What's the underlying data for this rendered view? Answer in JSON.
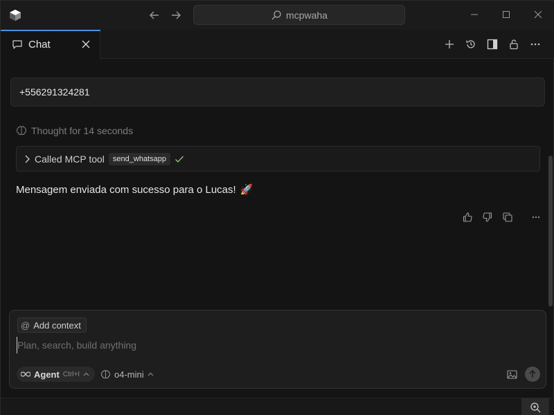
{
  "titlebar": {
    "search_text": "mcpwaha",
    "icons": [
      "app-logo",
      "arrow-left-icon",
      "arrow-right-icon",
      "search-icon",
      "minimize-icon",
      "maximize-icon",
      "close-icon"
    ]
  },
  "tabbar": {
    "active_tab_label": "Chat",
    "accent_color": "#4a90e2",
    "actions": [
      "plus-icon",
      "history-icon",
      "sidebar-toggle-icon",
      "unlock-icon",
      "more-icon"
    ]
  },
  "chat": {
    "user_message": "+556291324281",
    "thought_label": "Thought for 14 seconds",
    "tool_call": {
      "prefix": "Called MCP tool",
      "tool_name": "send_whatsapp",
      "status": "success"
    },
    "assistant_message": "Mensagem enviada com sucesso para o Lucas!",
    "assistant_emoji": "🚀"
  },
  "composer": {
    "add_context_label": "Add context",
    "placeholder": "Plan, search, build anything",
    "mode_label": "Agent",
    "mode_shortcut": "Ctrl+I",
    "model_label": "o4-mini"
  }
}
